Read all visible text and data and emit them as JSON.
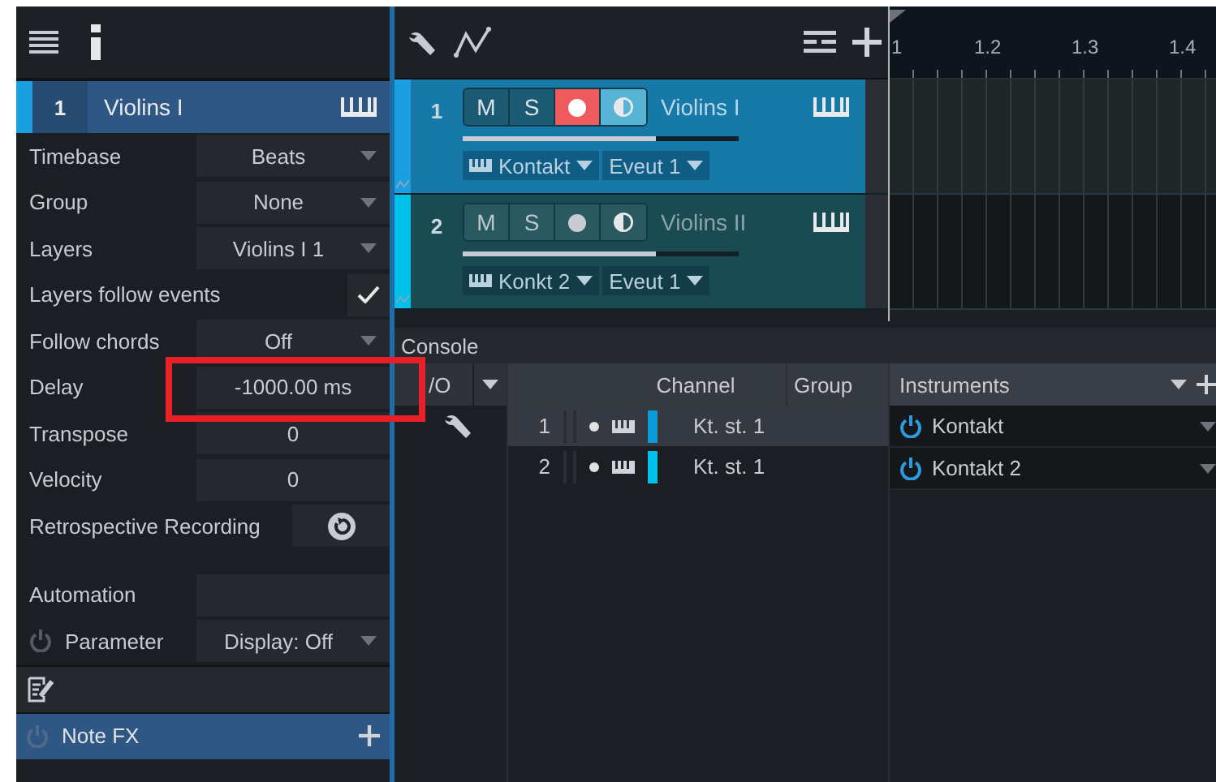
{
  "inspector": {
    "track": {
      "number": "1",
      "name": "Violins I",
      "color": "#1aa0e0"
    },
    "properties": [
      {
        "kind": "dropdown",
        "label": "Timebase",
        "value": "Beats"
      },
      {
        "kind": "dropdown",
        "label": "Group",
        "value": "None"
      },
      {
        "kind": "dropdown",
        "label": "Layers",
        "value": "Violins I 1"
      },
      {
        "kind": "check",
        "label": "Layers follow events",
        "checked": true
      },
      {
        "kind": "dropdown",
        "label": "Follow chords",
        "value": "Off"
      },
      {
        "kind": "field",
        "label": "Delay",
        "value": "-1000.00 ms"
      },
      {
        "kind": "field",
        "label": "Transpose",
        "value": "0"
      },
      {
        "kind": "field",
        "label": "Velocity",
        "value": "0"
      },
      {
        "kind": "button",
        "label": "Retrospective Recording"
      }
    ],
    "automation": {
      "label": "Automation",
      "parameter_label": "Parameter",
      "parameter_on": false,
      "display": "Display: Off"
    },
    "note_fx": {
      "label": "Note FX",
      "on": false
    }
  },
  "tracks": [
    {
      "number": "1",
      "name": "Violins I",
      "selected": true,
      "color": "#1aa0e0",
      "mute_label": "M",
      "solo_label": "S",
      "record": true,
      "monitor": true,
      "level": 0.7,
      "instrument": "Kontakt",
      "output": "Eveut 1"
    },
    {
      "number": "2",
      "name": "Violins II",
      "selected": false,
      "color": "#00c0ec",
      "mute_label": "M",
      "solo_label": "S",
      "record": false,
      "monitor": false,
      "level": 0.7,
      "instrument": "Konkt 2",
      "output": "Eveut 1"
    }
  ],
  "ruler_labels": [
    "1",
    "1.2",
    "1.3",
    "1.4"
  ],
  "console": {
    "title": "Console",
    "io_header": "/O",
    "columns": [
      "Channel",
      "Group"
    ],
    "channels": [
      {
        "number": "1",
        "name": "Kt. st. 1",
        "selected": true,
        "color": "#0a9ad8"
      },
      {
        "number": "2",
        "name": "Kt. st. 1",
        "selected": false,
        "color": "#00c0ec"
      }
    ],
    "instruments": {
      "title": "Instruments",
      "items": [
        {
          "name": "Kontakt",
          "on": true
        },
        {
          "name": "Kontakt 2",
          "on": true
        }
      ]
    }
  }
}
